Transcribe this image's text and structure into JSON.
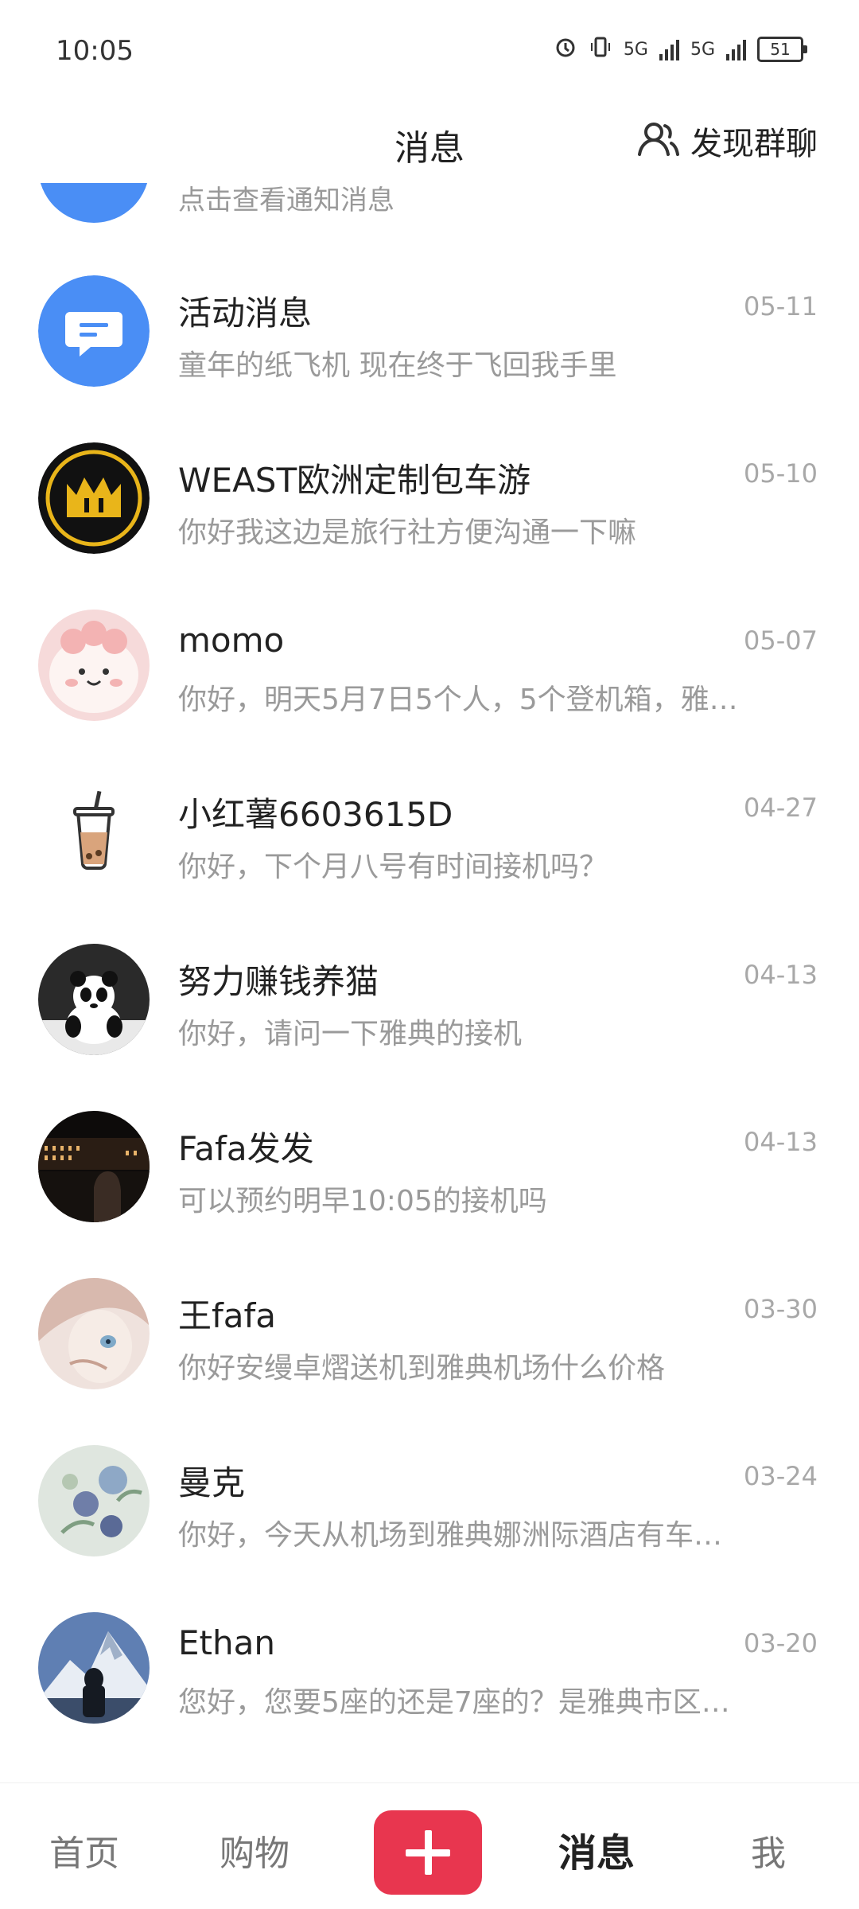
{
  "status_bar": {
    "time": "10:05",
    "battery": "51",
    "net1": "5G",
    "net2": "5G"
  },
  "header": {
    "title": "消息",
    "find_group": "发现群聊"
  },
  "partial_item": {
    "preview": "点击查看通知消息"
  },
  "messages": [
    {
      "name": "活动消息",
      "date": "05-11",
      "preview": "童年的纸飞机 现在终于飞回我手里",
      "avatar": "bubble-icon"
    },
    {
      "name": "WEAST欧洲定制包车游",
      "date": "05-10",
      "preview": "你好我这边是旅行社方便沟通一下嘛",
      "avatar": "crown-logo"
    },
    {
      "name": "momo",
      "date": "05-07",
      "preview": "你好，明天5月7日5个人，5个登机箱，雅…",
      "avatar": "cartoon-avatar"
    },
    {
      "name": "小红薯6603615D",
      "date": "04-27",
      "preview": "你好，下个月八号有时间接机吗？",
      "avatar": "bubble-tea-icon"
    },
    {
      "name": "努力赚钱养猫",
      "date": "04-13",
      "preview": "你好，请问一下雅典的接机",
      "avatar": "panda-avatar"
    },
    {
      "name": "Fafa发发",
      "date": "04-13",
      "preview": "可以预约明早10:05的接机吗",
      "avatar": "night-photo-avatar"
    },
    {
      "name": "王fafa",
      "date": "03-30",
      "preview": "你好安缦卓熠送机到雅典机场什么价格",
      "avatar": "anime-avatar"
    },
    {
      "name": "曼克",
      "date": "03-24",
      "preview": "你好，今天从机场到雅典娜洲际酒店有车…",
      "avatar": "flower-avatar"
    },
    {
      "name": "Ethan",
      "date": "03-20",
      "preview": "您好，您要5座的还是7座的？是雅典市区…",
      "avatar": "mountain-avatar"
    }
  ],
  "bottom_nav": {
    "home": "首页",
    "shop": "购物",
    "messages": "消息",
    "me": "我"
  },
  "colors": {
    "accent": "#e8364f",
    "notify_blue": "#4a8ef5"
  }
}
